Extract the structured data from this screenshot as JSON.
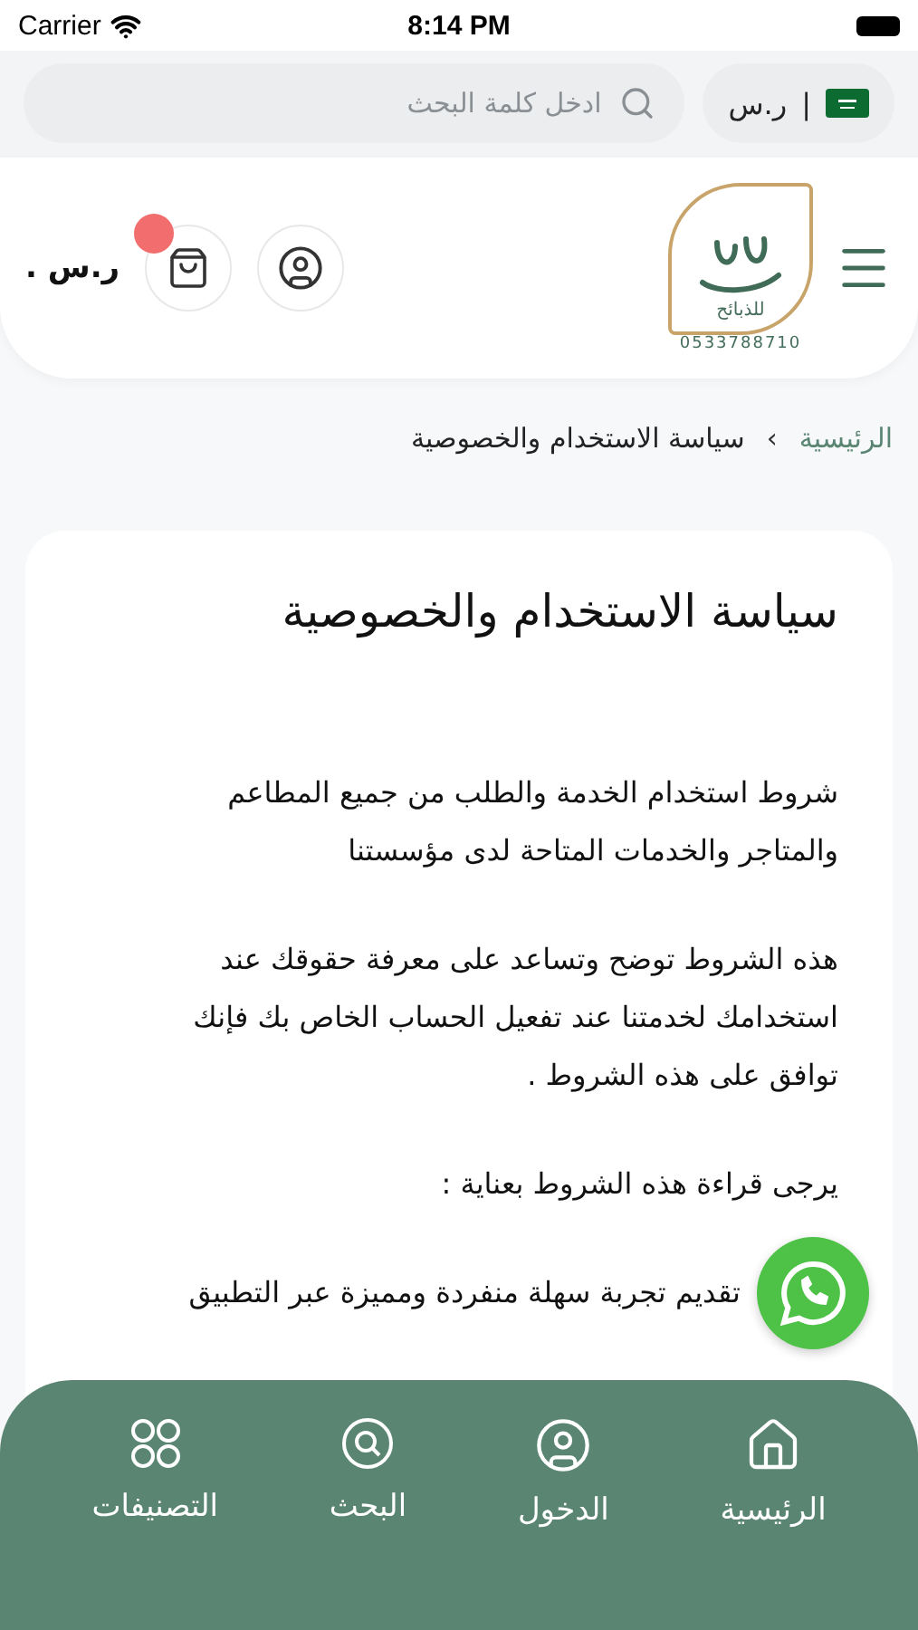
{
  "status_bar": {
    "carrier": "Carrier",
    "time": "8:14 PM"
  },
  "top_bar": {
    "divider": "|",
    "currency": "ر.س",
    "search": {
      "placeholder": "ادخل كلمة البحث"
    }
  },
  "header": {
    "logo_caption": "للذبائح",
    "logo_phone": "0533788710",
    "cart_badge": true,
    "price": "ر.س ."
  },
  "breadcrumb": {
    "home": "الرئيسية",
    "separator": "›",
    "current": "سياسة الاستخدام والخصوصية"
  },
  "content": {
    "title": "سياسة الاستخدام والخصوصية",
    "paragraphs": [
      "شروط استخدام الخدمة والطلب من جميع المطاعم والمتاجر والخدمات المتاحة لدى مؤسستنا",
      "هذه الشروط توضح وتساعد على معرفة حقوقك عند استخدامك لخدمتنا عند تفعيل الحساب الخاص بك فإنك توافق على هذه الشروط .",
      "يرجى قراءة هذه الشروط بعناية :",
      "تقديم تجربة سهلة منفردة ومميزة عبر التطبيق"
    ]
  },
  "bottom_nav": [
    {
      "kind": "home",
      "label": "الرئيسية"
    },
    {
      "kind": "user",
      "label": "الدخول"
    },
    {
      "kind": "search",
      "label": "البحث"
    },
    {
      "kind": "grid",
      "label": "التصنيفات"
    }
  ]
}
